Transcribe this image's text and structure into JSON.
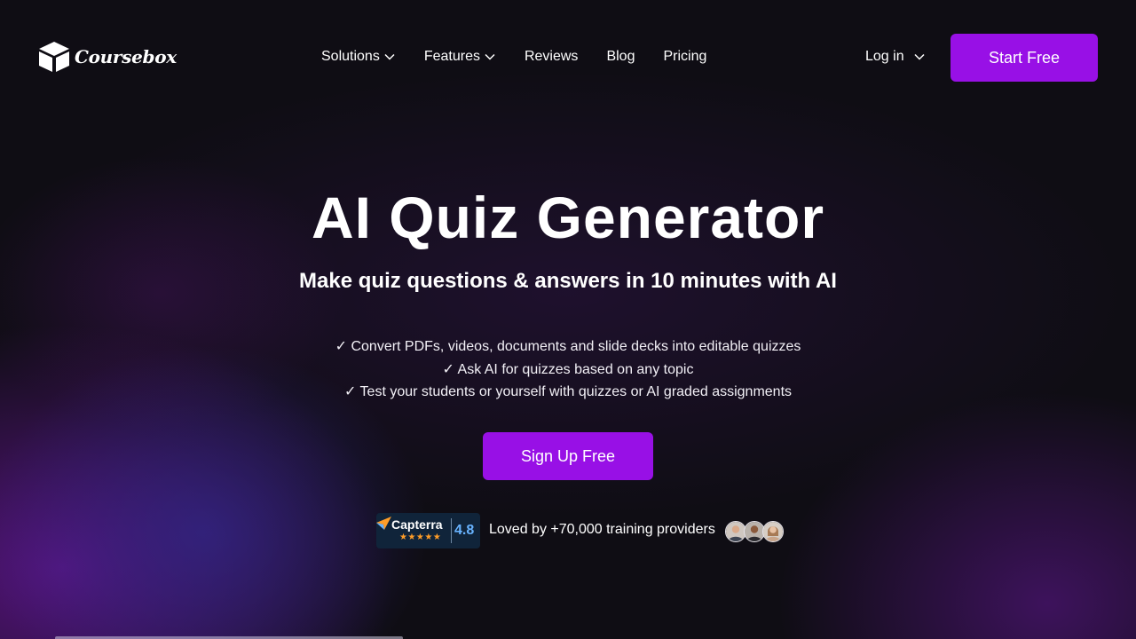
{
  "header": {
    "logo_text": "Coursebox",
    "nav": {
      "solutions": "Solutions",
      "features": "Features",
      "reviews": "Reviews",
      "blog": "Blog",
      "pricing": "Pricing"
    },
    "login_label": "Log in",
    "start_label": "Start Free"
  },
  "hero": {
    "title": "AI Quiz Generator",
    "subtitle": "Make quiz questions & answers in 10 minutes with AI",
    "benefits": [
      "✓ Convert PDFs, videos, documents and slide decks into editable quizzes",
      "✓ Ask AI for quizzes based on any topic",
      "✓ Test your students or yourself with quizzes or AI graded assignments"
    ],
    "cta_label": "Sign Up Free"
  },
  "social_proof": {
    "capterra_name": "Capterra",
    "capterra_stars": "★★★★★",
    "capterra_rating": "4.8",
    "loved_text": "Loved by +70,000 training providers"
  },
  "colors": {
    "accent": "#9810e6",
    "background": "#0f0d14",
    "capterra_bg": "#10243a",
    "capterra_rating": "#68b3ff",
    "star": "#ff9d28"
  },
  "icons": {
    "logo": "box-logo-icon",
    "dropdown": "chevron-down-icon",
    "capterra": "capterra-arrow-icon",
    "avatar": "user-avatar"
  }
}
